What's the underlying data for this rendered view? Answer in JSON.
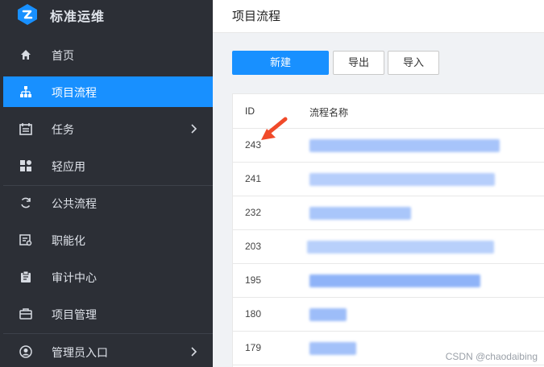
{
  "brand": {
    "name": "标准运维"
  },
  "sidebar": {
    "items": [
      {
        "label": "首页",
        "icon": "home-icon"
      },
      {
        "label": "项目流程",
        "icon": "org-chart-icon",
        "active": true
      },
      {
        "label": "任务",
        "icon": "task-list-icon",
        "has_children": true
      },
      {
        "label": "轻应用",
        "icon": "app-grid-icon"
      },
      {
        "label": "公共流程",
        "icon": "sync-icon"
      },
      {
        "label": "职能化",
        "icon": "functional-icon"
      },
      {
        "label": "审计中心",
        "icon": "clipboard-icon"
      },
      {
        "label": "项目管理",
        "icon": "briefcase-icon"
      },
      {
        "label": "管理员入口",
        "icon": "user-circle-icon",
        "has_children": true
      }
    ]
  },
  "header": {
    "title": "项目流程"
  },
  "toolbar": {
    "new_label": "新建",
    "export_label": "导出",
    "import_label": "导入"
  },
  "table": {
    "columns": [
      "ID",
      "流程名称"
    ],
    "rows": [
      {
        "id": "243"
      },
      {
        "id": "241"
      },
      {
        "id": "232"
      },
      {
        "id": "203"
      },
      {
        "id": "195"
      },
      {
        "id": "180"
      },
      {
        "id": "179"
      }
    ]
  },
  "watermark": "CSDN @chaodaibing",
  "colors": {
    "sidebar_bg": "#2c2f36",
    "accent": "#1890ff",
    "annotation_arrow": "#f04a2a"
  }
}
